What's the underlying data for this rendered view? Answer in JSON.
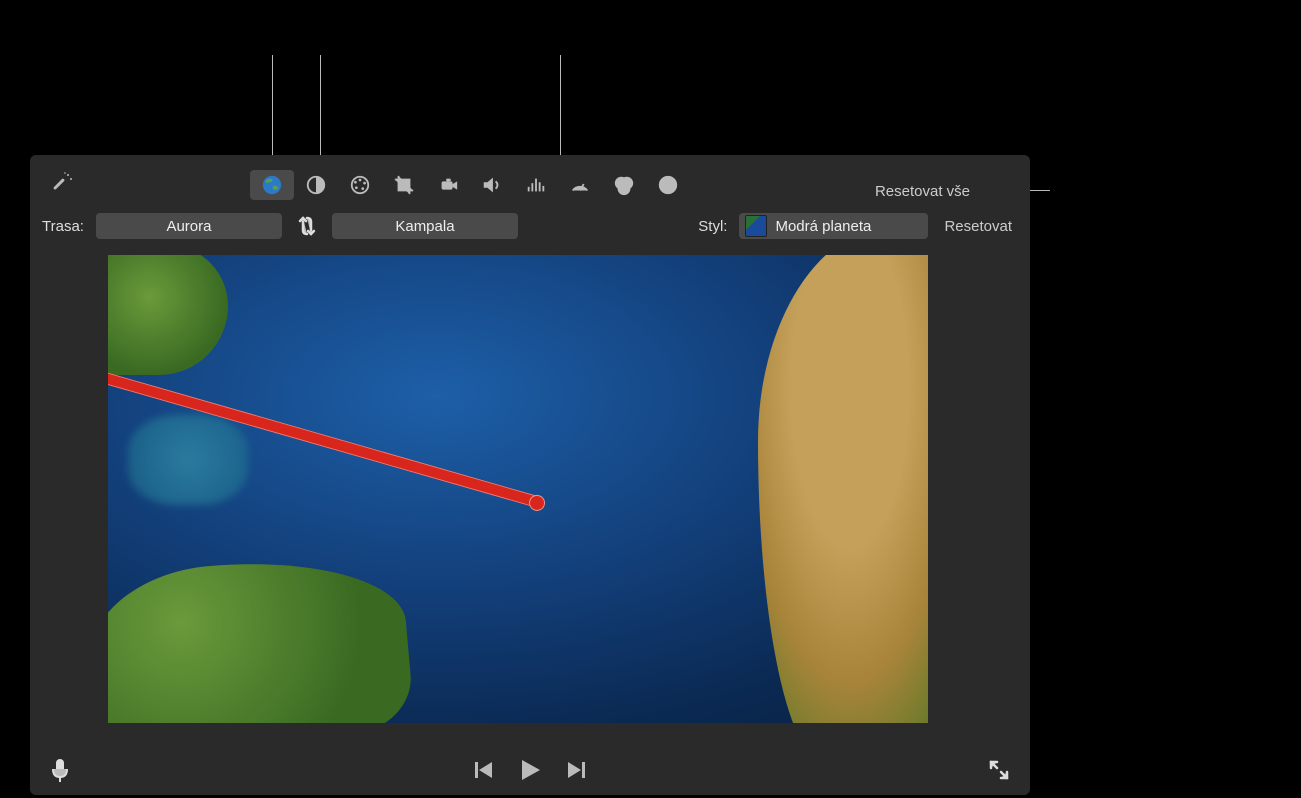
{
  "toolbar": {
    "reset_all": "Resetovat vše"
  },
  "route": {
    "label": "Trasa:",
    "start": "Aurora",
    "end": "Kampala"
  },
  "style": {
    "label": "Styl:",
    "value": "Modrá planeta",
    "reset": "Resetovat"
  },
  "icons": {
    "magic": "magic-wand-icon",
    "globe": "globe-icon",
    "balance": "color-balance-icon",
    "palette": "palette-icon",
    "crop": "crop-icon",
    "camera": "camera-icon",
    "volume": "volume-icon",
    "eq": "equalizer-icon",
    "speed": "speedometer-icon",
    "filters": "filters-icon",
    "info": "info-icon",
    "swap": "swap-icon",
    "mic": "microphone-icon",
    "prev": "previous-icon",
    "play": "play-icon",
    "next": "next-icon",
    "expand": "expand-icon"
  }
}
